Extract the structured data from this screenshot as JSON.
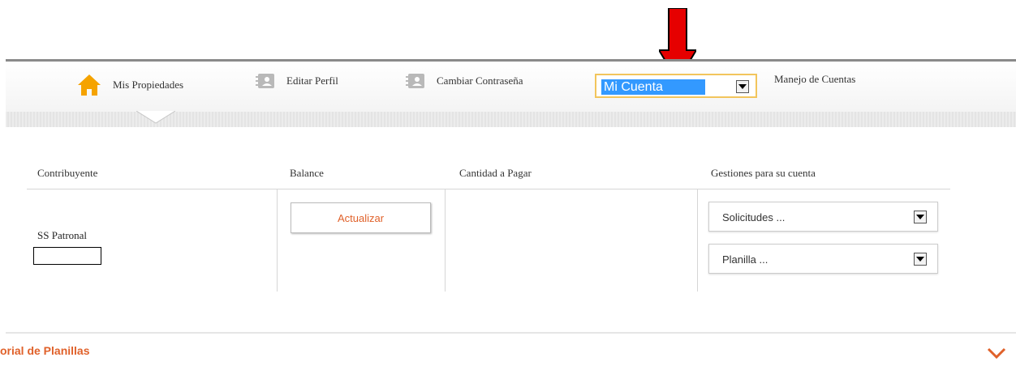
{
  "nav": {
    "items": [
      {
        "label": "Mis Propiedades",
        "icon": "home-icon"
      },
      {
        "label": "Editar Perfil",
        "icon": "contact-card-icon"
      },
      {
        "label": "Cambiar Contraseña",
        "icon": "contact-card-icon"
      },
      {
        "label": "Manejo de Cuentas"
      }
    ],
    "account_select": {
      "value": "Mi Cuenta"
    }
  },
  "table": {
    "headers": [
      "Contribuyente",
      "Balance",
      "Cantidad a Pagar",
      "Gestiones para su cuenta"
    ],
    "contribuyente_label": "SS Patronal",
    "actualizar_label": "Actualizar",
    "gestiones": [
      {
        "value": "Solicitudes ..."
      },
      {
        "value": "Planilla ..."
      }
    ]
  },
  "section": {
    "title": "orial de Planillas"
  },
  "colors": {
    "accent": "#e0612a",
    "home_icon": "#f5a300",
    "annotation_arrow": "#e60000",
    "selection": "#3399ff"
  }
}
